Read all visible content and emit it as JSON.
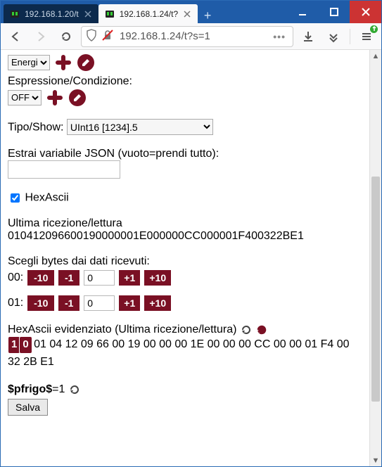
{
  "browser": {
    "tabs": [
      {
        "label": "192.168.1.20/t",
        "active": false
      },
      {
        "label": "192.168.1.24/t?",
        "active": true
      }
    ],
    "url": "192.168.1.24/t?s=1"
  },
  "form": {
    "select_energi": "Energi",
    "label_espr": "Espressione/Condizione:",
    "select_off": "OFF",
    "label_tipo": "Tipo/Show:",
    "select_tipo": "UInt16 [1234].5",
    "label_json": "Estrai variabile JSON (vuoto=prendi tutto):",
    "json_value": "",
    "hexascii_label": "HexAscii"
  },
  "last_rx": {
    "label": "Ultima ricezione/lettura",
    "value": "010412096600190000001E000000CC000001F400322BE1"
  },
  "bytes": {
    "label": "Scegli bytes dai dati ricevuti:",
    "rows": [
      {
        "name": "00:",
        "m10": "-10",
        "m1": "-1",
        "val": "0",
        "p1": "+1",
        "p10": "+10"
      },
      {
        "name": "01:",
        "m10": "-10",
        "m1": "-1",
        "val": "0",
        "p1": "+1",
        "p10": "+10"
      }
    ]
  },
  "hilite": {
    "label": "HexAscii evidenziato (Ultima ricezione/lettura)",
    "marks": [
      "1",
      "0"
    ],
    "rest": "01 04 12 09 66 00 19 00 00 00 1E 00 00 00 CC 00 00 01 F4 00 32 2B E1"
  },
  "result": {
    "name": "$pfrigo$",
    "eq": "=",
    "value": "1"
  },
  "buttons": {
    "save": "Salva"
  }
}
